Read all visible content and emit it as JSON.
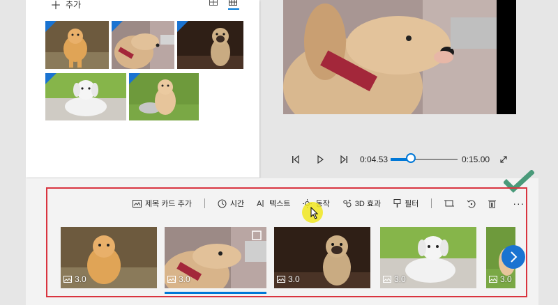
{
  "library": {
    "add_label": "추가",
    "view_icons": [
      "list-view-icon",
      "grid-view-icon"
    ],
    "thumbs": [
      {
        "name": "pomeranian",
        "colors": [
          "#6d5a3e",
          "#e0a456"
        ]
      },
      {
        "name": "golden-retriever-hand",
        "colors": [
          "#9c8a86",
          "#d8b48a"
        ]
      },
      {
        "name": "pug",
        "colors": [
          "#2f1f16",
          "#c9ab82"
        ]
      },
      {
        "name": "white-puppy",
        "colors": [
          "#86b54a",
          "#f2f2f2"
        ]
      },
      {
        "name": "golden-puppy",
        "colors": [
          "#6e9a3c",
          "#e7c59b"
        ]
      }
    ]
  },
  "player": {
    "current_time": "0:04.53",
    "total_time": "0:15.00",
    "progress": 0.302
  },
  "toolbar": {
    "title_card": "제목 카드 추가",
    "duration": "시간",
    "text": "텍스트",
    "motion": "동작",
    "effects_3d": "3D 효과",
    "filters": "필터"
  },
  "storyboard": {
    "clips": [
      {
        "duration": "3.0",
        "selected": false
      },
      {
        "duration": "3.0",
        "selected": true
      },
      {
        "duration": "3.0",
        "selected": false
      },
      {
        "duration": "3.0",
        "selected": false
      },
      {
        "duration": "3.0",
        "selected": false
      }
    ]
  },
  "colors": {
    "accent": "#0078d7",
    "highlight": "#d9343f",
    "check": "#4a9a7a"
  }
}
